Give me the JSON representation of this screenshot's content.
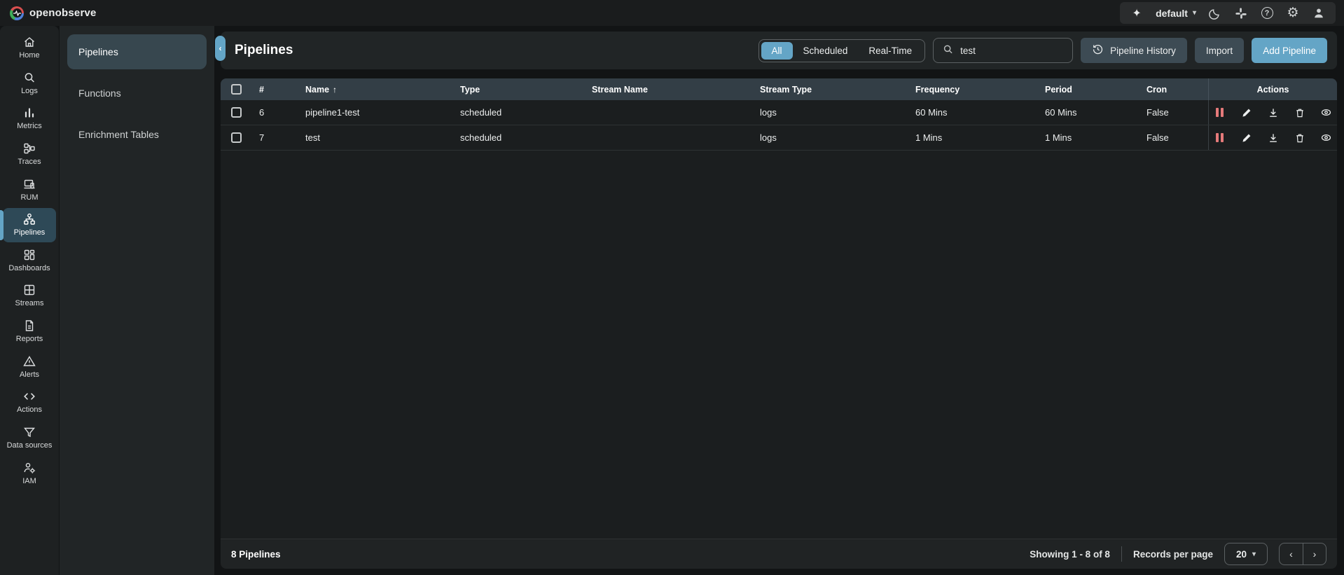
{
  "topbar": {
    "brand": "openobserve",
    "org_selector": {
      "value": "default"
    },
    "icons": [
      "sparkle-icon",
      "moon-icon",
      "slack-icon",
      "help-icon",
      "gear-icon",
      "profile-icon"
    ]
  },
  "glyphs": {
    "sparkle": "✦",
    "caret_down": "▾",
    "gear": "⚙",
    "help": "?",
    "collapse": "‹",
    "sort_asc": "↑",
    "prev": "‹",
    "next": "›"
  },
  "sidebar": {
    "items": [
      {
        "label": "Home",
        "icon": "home-icon"
      },
      {
        "label": "Logs",
        "icon": "search-icon"
      },
      {
        "label": "Metrics",
        "icon": "bar-chart-icon"
      },
      {
        "label": "Traces",
        "icon": "traces-icon"
      },
      {
        "label": "RUM",
        "icon": "monitor-icon"
      },
      {
        "label": "Pipelines",
        "icon": "pipeline-tree-icon"
      },
      {
        "label": "Dashboards",
        "icon": "dashboards-grid-icon"
      },
      {
        "label": "Streams",
        "icon": "streams-table-icon"
      },
      {
        "label": "Reports",
        "icon": "document-icon"
      },
      {
        "label": "Alerts",
        "icon": "warning-triangle-icon"
      },
      {
        "label": "Actions",
        "icon": "code-brackets-icon"
      },
      {
        "label": "Data sources",
        "icon": "funnel-icon"
      },
      {
        "label": "IAM",
        "icon": "user-gear-icon"
      }
    ],
    "active": "Pipelines"
  },
  "subsidebar": {
    "items": [
      {
        "label": "Pipelines"
      },
      {
        "label": "Functions"
      },
      {
        "label": "Enrichment Tables"
      }
    ],
    "active": "Pipelines"
  },
  "main": {
    "title": "Pipelines",
    "filter_tabs": [
      {
        "label": "All",
        "active": true
      },
      {
        "label": "Scheduled",
        "active": false
      },
      {
        "label": "Real-Time",
        "active": false
      }
    ],
    "search": {
      "value": "test"
    },
    "buttons": {
      "history": "Pipeline History",
      "import": "Import",
      "add": "Add Pipeline"
    },
    "table": {
      "columns": [
        "#",
        "Name",
        "Type",
        "Stream Name",
        "Stream Type",
        "Frequency",
        "Period",
        "Cron",
        "Actions"
      ],
      "sorted_by": "Name",
      "rows": [
        {
          "num": "6",
          "name": "pipeline1-test",
          "type": "scheduled",
          "stream_name": "",
          "stream_type": "logs",
          "frequency": "60 Mins",
          "period": "60 Mins",
          "cron": "False"
        },
        {
          "num": "7",
          "name": "test",
          "type": "scheduled",
          "stream_name": "",
          "stream_type": "logs",
          "frequency": "1 Mins",
          "period": "1 Mins",
          "cron": "False"
        }
      ],
      "row_actions": [
        "pause-icon",
        "edit-icon",
        "download-icon",
        "delete-icon",
        "view-icon"
      ]
    },
    "footer": {
      "total": "8 Pipelines",
      "showing": "Showing 1 - 8 of 8",
      "records_per_page_label": "Records per page",
      "page_size": "20"
    }
  },
  "colors": {
    "accent_blue": "#64a5c6",
    "header_row": "#333e46",
    "selected_item": "#37474f",
    "pause_red": "#e57a7a",
    "panel": "#212526",
    "page_bg": "#121415"
  }
}
